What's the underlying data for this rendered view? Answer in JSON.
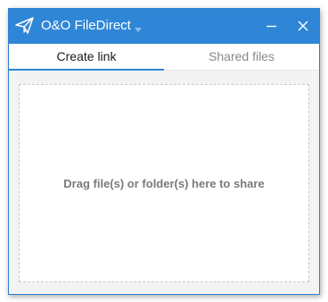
{
  "window": {
    "title": "O&O FileDirect",
    "accent_color": "#2f86d7",
    "icons": {
      "app": "paper-plane-icon",
      "dropdown": "chevron-down-icon",
      "minimize": "minimize-icon",
      "close": "close-icon"
    }
  },
  "tabs": [
    {
      "label": "Create link",
      "active": true
    },
    {
      "label": "Shared files",
      "active": false
    }
  ],
  "dropzone": {
    "text": "Drag file(s) or folder(s) here to share"
  }
}
